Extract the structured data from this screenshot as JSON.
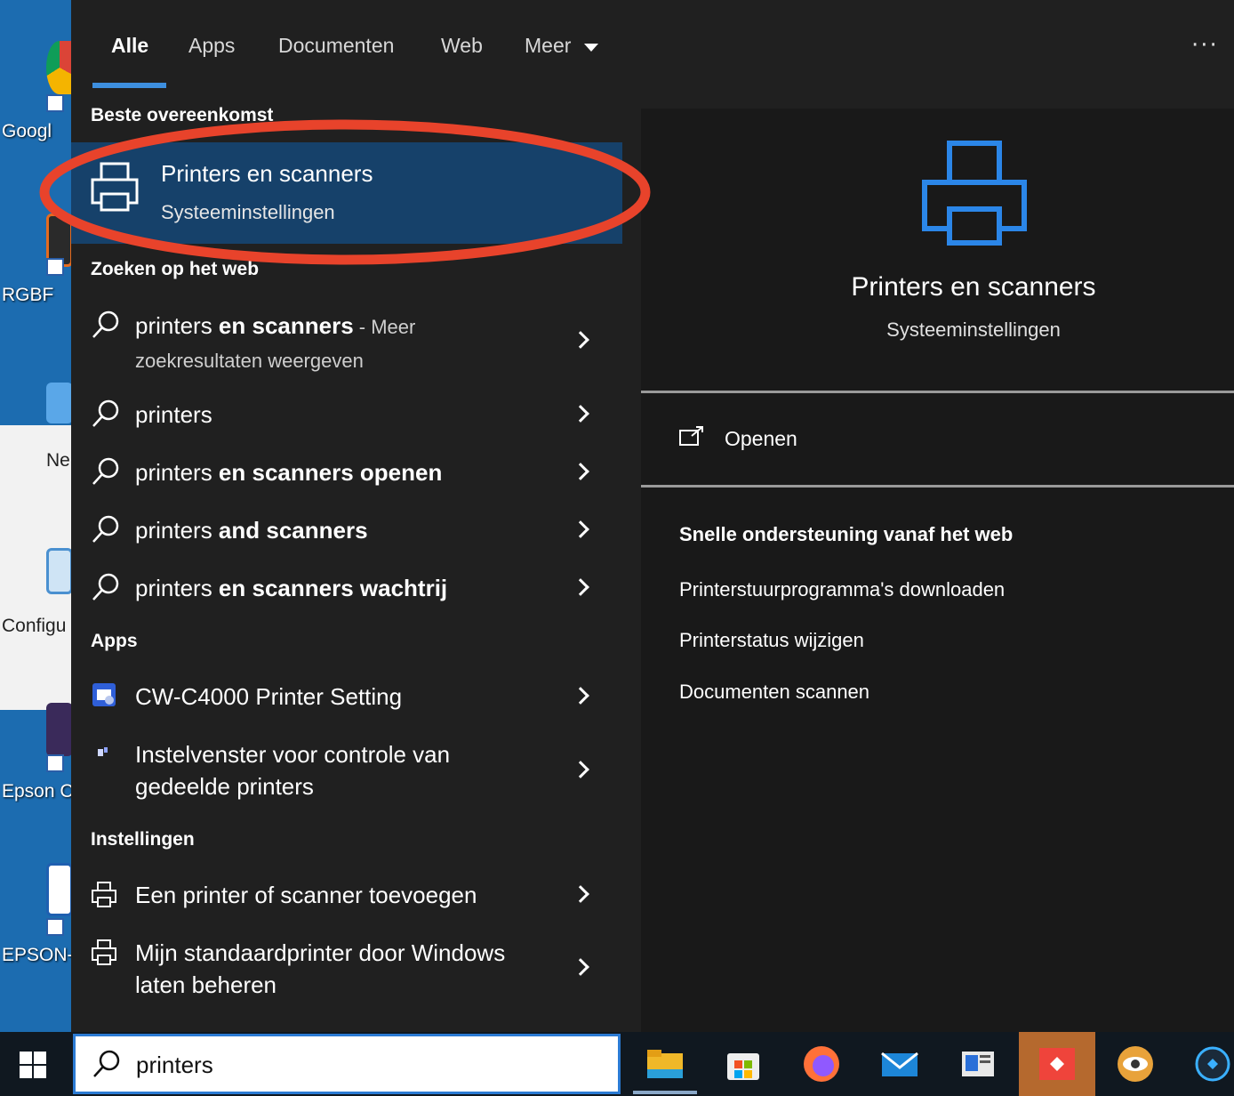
{
  "tabs": [
    {
      "label": "Alle"
    },
    {
      "label": "Apps"
    },
    {
      "label": "Documenten"
    },
    {
      "label": "Web"
    },
    {
      "label": "Meer"
    }
  ],
  "more_options": "···",
  "desktop_icons": [
    {
      "label": "Googl"
    },
    {
      "label": "RGBF"
    },
    {
      "label": "Ne"
    },
    {
      "label": "Configu"
    },
    {
      "label": "Epson C"
    },
    {
      "label": "EPSON-"
    }
  ],
  "best_match": {
    "heading": "Beste overeenkomst",
    "title": "Printers en scanners",
    "subtitle": "Systeeminstellingen"
  },
  "web": {
    "heading": "Zoeken op het web",
    "items": [
      {
        "normal": "printers ",
        "bold": "en scanners",
        "muted": " - Meer",
        "line2": "zoekresultaten weergeven"
      },
      {
        "normal": "printers",
        "bold": "",
        "muted": "",
        "line2": ""
      },
      {
        "normal": "printers ",
        "bold": "en scanners openen",
        "muted": "",
        "line2": ""
      },
      {
        "normal": "printers ",
        "bold": "and scanners",
        "muted": "",
        "line2": ""
      },
      {
        "normal": "printers ",
        "bold": "en scanners wachtrij",
        "muted": "",
        "line2": ""
      }
    ]
  },
  "apps": {
    "heading": "Apps",
    "items": [
      {
        "line1": "CW-C4000 Printer Setting",
        "line2": ""
      },
      {
        "line1": "Instelvenster voor controle van",
        "line2": "gedeelde printers"
      }
    ]
  },
  "settings": {
    "heading": "Instellingen",
    "items": [
      {
        "line1": "Een printer of scanner toevoegen",
        "line2": ""
      },
      {
        "line1": "Mijn standaardprinter door Windows",
        "line2": "laten beheren"
      }
    ]
  },
  "preview": {
    "title": "Printers en scanners",
    "subtitle": "Systeeminstellingen",
    "open_label": "Openen",
    "quick_heading": "Snelle ondersteuning vanaf het web",
    "quick_links": [
      "Printerstuurprogramma's downloaden",
      "Printerstatus wijzigen",
      "Documenten scannen"
    ]
  },
  "search": {
    "value": "printers"
  },
  "colors": {
    "panel_bg": "#202020",
    "selected_bg": "#16416a",
    "accent": "#3d8fdf",
    "highlight_ring": "#e8432b"
  },
  "taskbar_icons": [
    "file-explorer-icon",
    "store-icon",
    "firefox-icon",
    "mail-icon",
    "news-icon",
    "anydesk-icon",
    "eye-app-icon",
    "network-app-icon"
  ]
}
